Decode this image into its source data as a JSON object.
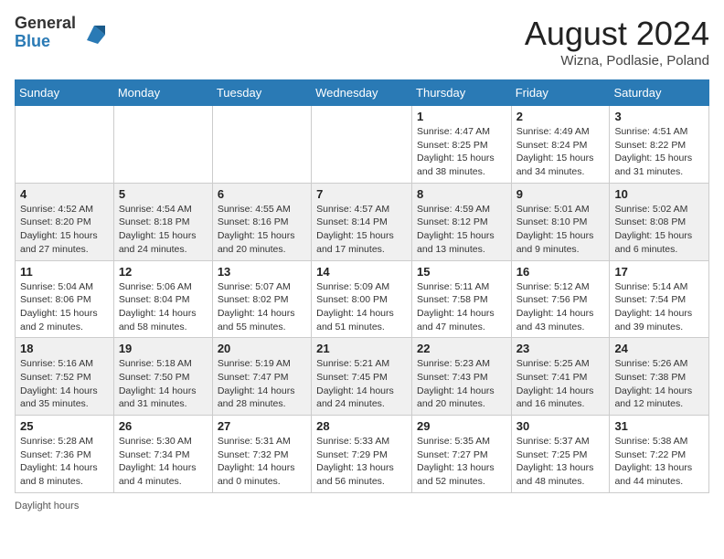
{
  "header": {
    "logo_general": "General",
    "logo_blue": "Blue",
    "month_year": "August 2024",
    "location": "Wizna, Podlasie, Poland"
  },
  "weekdays": [
    "Sunday",
    "Monday",
    "Tuesday",
    "Wednesday",
    "Thursday",
    "Friday",
    "Saturday"
  ],
  "footer": {
    "daylight_hours_label": "Daylight hours"
  },
  "weeks": [
    {
      "days": [
        {
          "num": "",
          "info": ""
        },
        {
          "num": "",
          "info": ""
        },
        {
          "num": "",
          "info": ""
        },
        {
          "num": "",
          "info": ""
        },
        {
          "num": "1",
          "info": "Sunrise: 4:47 AM\nSunset: 8:25 PM\nDaylight: 15 hours\nand 38 minutes."
        },
        {
          "num": "2",
          "info": "Sunrise: 4:49 AM\nSunset: 8:24 PM\nDaylight: 15 hours\nand 34 minutes."
        },
        {
          "num": "3",
          "info": "Sunrise: 4:51 AM\nSunset: 8:22 PM\nDaylight: 15 hours\nand 31 minutes."
        }
      ]
    },
    {
      "days": [
        {
          "num": "4",
          "info": "Sunrise: 4:52 AM\nSunset: 8:20 PM\nDaylight: 15 hours\nand 27 minutes."
        },
        {
          "num": "5",
          "info": "Sunrise: 4:54 AM\nSunset: 8:18 PM\nDaylight: 15 hours\nand 24 minutes."
        },
        {
          "num": "6",
          "info": "Sunrise: 4:55 AM\nSunset: 8:16 PM\nDaylight: 15 hours\nand 20 minutes."
        },
        {
          "num": "7",
          "info": "Sunrise: 4:57 AM\nSunset: 8:14 PM\nDaylight: 15 hours\nand 17 minutes."
        },
        {
          "num": "8",
          "info": "Sunrise: 4:59 AM\nSunset: 8:12 PM\nDaylight: 15 hours\nand 13 minutes."
        },
        {
          "num": "9",
          "info": "Sunrise: 5:01 AM\nSunset: 8:10 PM\nDaylight: 15 hours\nand 9 minutes."
        },
        {
          "num": "10",
          "info": "Sunrise: 5:02 AM\nSunset: 8:08 PM\nDaylight: 15 hours\nand 6 minutes."
        }
      ]
    },
    {
      "days": [
        {
          "num": "11",
          "info": "Sunrise: 5:04 AM\nSunset: 8:06 PM\nDaylight: 15 hours\nand 2 minutes."
        },
        {
          "num": "12",
          "info": "Sunrise: 5:06 AM\nSunset: 8:04 PM\nDaylight: 14 hours\nand 58 minutes."
        },
        {
          "num": "13",
          "info": "Sunrise: 5:07 AM\nSunset: 8:02 PM\nDaylight: 14 hours\nand 55 minutes."
        },
        {
          "num": "14",
          "info": "Sunrise: 5:09 AM\nSunset: 8:00 PM\nDaylight: 14 hours\nand 51 minutes."
        },
        {
          "num": "15",
          "info": "Sunrise: 5:11 AM\nSunset: 7:58 PM\nDaylight: 14 hours\nand 47 minutes."
        },
        {
          "num": "16",
          "info": "Sunrise: 5:12 AM\nSunset: 7:56 PM\nDaylight: 14 hours\nand 43 minutes."
        },
        {
          "num": "17",
          "info": "Sunrise: 5:14 AM\nSunset: 7:54 PM\nDaylight: 14 hours\nand 39 minutes."
        }
      ]
    },
    {
      "days": [
        {
          "num": "18",
          "info": "Sunrise: 5:16 AM\nSunset: 7:52 PM\nDaylight: 14 hours\nand 35 minutes."
        },
        {
          "num": "19",
          "info": "Sunrise: 5:18 AM\nSunset: 7:50 PM\nDaylight: 14 hours\nand 31 minutes."
        },
        {
          "num": "20",
          "info": "Sunrise: 5:19 AM\nSunset: 7:47 PM\nDaylight: 14 hours\nand 28 minutes."
        },
        {
          "num": "21",
          "info": "Sunrise: 5:21 AM\nSunset: 7:45 PM\nDaylight: 14 hours\nand 24 minutes."
        },
        {
          "num": "22",
          "info": "Sunrise: 5:23 AM\nSunset: 7:43 PM\nDaylight: 14 hours\nand 20 minutes."
        },
        {
          "num": "23",
          "info": "Sunrise: 5:25 AM\nSunset: 7:41 PM\nDaylight: 14 hours\nand 16 minutes."
        },
        {
          "num": "24",
          "info": "Sunrise: 5:26 AM\nSunset: 7:38 PM\nDaylight: 14 hours\nand 12 minutes."
        }
      ]
    },
    {
      "days": [
        {
          "num": "25",
          "info": "Sunrise: 5:28 AM\nSunset: 7:36 PM\nDaylight: 14 hours\nand 8 minutes."
        },
        {
          "num": "26",
          "info": "Sunrise: 5:30 AM\nSunset: 7:34 PM\nDaylight: 14 hours\nand 4 minutes."
        },
        {
          "num": "27",
          "info": "Sunrise: 5:31 AM\nSunset: 7:32 PM\nDaylight: 14 hours\nand 0 minutes."
        },
        {
          "num": "28",
          "info": "Sunrise: 5:33 AM\nSunset: 7:29 PM\nDaylight: 13 hours\nand 56 minutes."
        },
        {
          "num": "29",
          "info": "Sunrise: 5:35 AM\nSunset: 7:27 PM\nDaylight: 13 hours\nand 52 minutes."
        },
        {
          "num": "30",
          "info": "Sunrise: 5:37 AM\nSunset: 7:25 PM\nDaylight: 13 hours\nand 48 minutes."
        },
        {
          "num": "31",
          "info": "Sunrise: 5:38 AM\nSunset: 7:22 PM\nDaylight: 13 hours\nand 44 minutes."
        }
      ]
    }
  ]
}
